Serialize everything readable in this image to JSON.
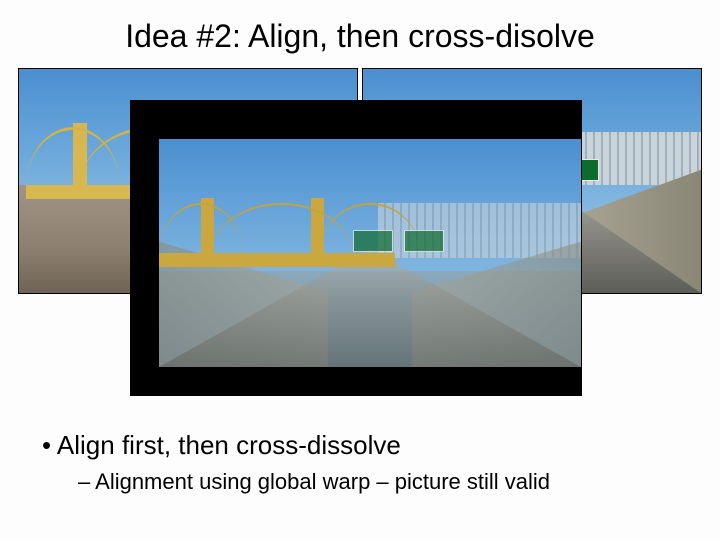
{
  "title": "Idea #2: Align, then cross-disolve",
  "bullets": {
    "main": "Align first, then cross-dissolve",
    "sub": "Alignment using global warp – picture still valid"
  }
}
